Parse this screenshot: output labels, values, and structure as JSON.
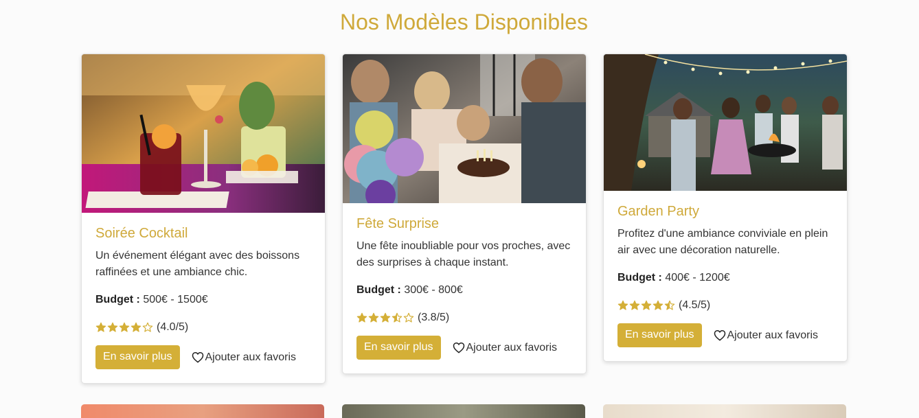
{
  "page": {
    "title": "Nos Modèles Disponibles"
  },
  "colors": {
    "accent": "#d4af37",
    "title": "#cfa93a",
    "star": "#d4af37"
  },
  "cards": [
    {
      "title": "Soirée Cocktail",
      "description": "Un événement élégant avec des boissons raffinées et une ambiance chic.",
      "budget_label": "Budget :",
      "budget_value": "500€ - 1500€",
      "rating": 4.0,
      "rating_text": "(4.0/5)",
      "button_label": "En savoir plus",
      "favorite_label": "Ajouter aux favoris",
      "icon": "heart-outline-icon"
    },
    {
      "title": "Fête Surprise",
      "description": "Une fête inoubliable pour vos proches, avec des surprises à chaque instant.",
      "budget_label": "Budget :",
      "budget_value": "300€ - 800€",
      "rating": 3.8,
      "rating_text": "(3.8/5)",
      "button_label": "En savoir plus",
      "favorite_label": "Ajouter aux favoris",
      "icon": "heart-outline-icon"
    },
    {
      "title": "Garden Party",
      "description": "Profitez d'une ambiance conviviale en plein air avec une décoration naturelle.",
      "budget_label": "Budget :",
      "budget_value": "400€ - 1200€",
      "rating": 4.5,
      "rating_text": "(4.5/5)",
      "button_label": "En savoir plus",
      "favorite_label": "Ajouter aux favoris",
      "icon": "heart-outline-icon"
    }
  ]
}
